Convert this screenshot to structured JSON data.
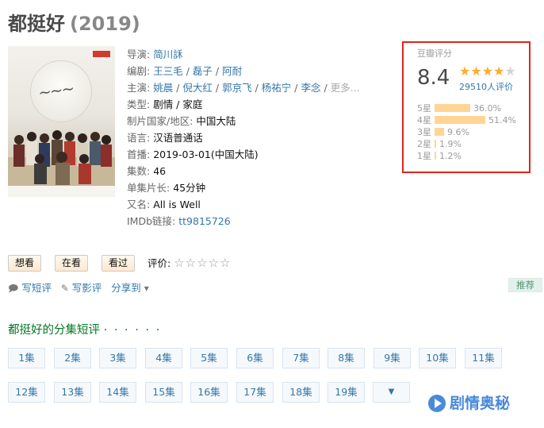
{
  "header": {
    "title": "都挺好",
    "year": "(2019)"
  },
  "info": {
    "director_key": "导演:",
    "director": "简川訸",
    "writer_key": "编剧:",
    "writers": [
      "王三毛",
      "磊子",
      "阿耐"
    ],
    "cast_key": "主演:",
    "cast": [
      "姚晨",
      "倪大红",
      "郭京飞",
      "杨祐宁",
      "李念"
    ],
    "cast_more": "更多...",
    "genre_key": "类型:",
    "genre": "剧情 / 家庭",
    "country_key": "制片国家/地区:",
    "country": "中国大陆",
    "language_key": "语言:",
    "language": "汉语普通话",
    "premiere_key": "首播:",
    "premiere": "2019-03-01(中国大陆)",
    "episodes_key": "集数:",
    "episodes": "46",
    "runtime_key": "单集片长:",
    "runtime": "45分钟",
    "aka_key": "又名:",
    "aka": "All is Well",
    "imdb_key": "IMDb链接:",
    "imdb": "tt9815726"
  },
  "rating": {
    "label": "豆瓣评分",
    "score": "8.4",
    "stars_filled": 4,
    "stars_total": 5,
    "votes": "29510人评价",
    "distribution": [
      {
        "label": "5星",
        "percent_text": "36.0%",
        "percent": 36.0
      },
      {
        "label": "4星",
        "percent_text": "51.4%",
        "percent": 51.4
      },
      {
        "label": "3星",
        "percent_text": "9.6%",
        "percent": 9.6
      },
      {
        "label": "2星",
        "percent_text": "1.9%",
        "percent": 1.9
      },
      {
        "label": "1星",
        "percent_text": "1.2%",
        "percent": 1.2
      }
    ]
  },
  "actions": {
    "want": "想看",
    "watching": "在看",
    "watched": "看过",
    "my_rating_label": "评价:",
    "my_rating_stars": "☆☆☆☆☆"
  },
  "tools": {
    "short_review": "写短评",
    "review": "写影评",
    "share": "分享到",
    "share_arrow": "▾",
    "recommend": "推荐"
  },
  "episodes_section": {
    "title": "都挺好的分集短评",
    "dots": "· · · · · ·",
    "buttons": [
      "1集",
      "2集",
      "3集",
      "4集",
      "5集",
      "6集",
      "7集",
      "8集",
      "9集",
      "10集",
      "11集",
      "12集",
      "13集",
      "14集",
      "15集",
      "16集",
      "17集",
      "18集",
      "19集"
    ],
    "more_icon": "▼"
  },
  "watermark": {
    "text": "剧情奥秘",
    "icon": "play-icon"
  },
  "colors": {
    "accent": "#3377aa",
    "highlight_border": "#e1251b",
    "star": "#ffac2d",
    "bar": "#ffd596",
    "green": "#007722"
  }
}
